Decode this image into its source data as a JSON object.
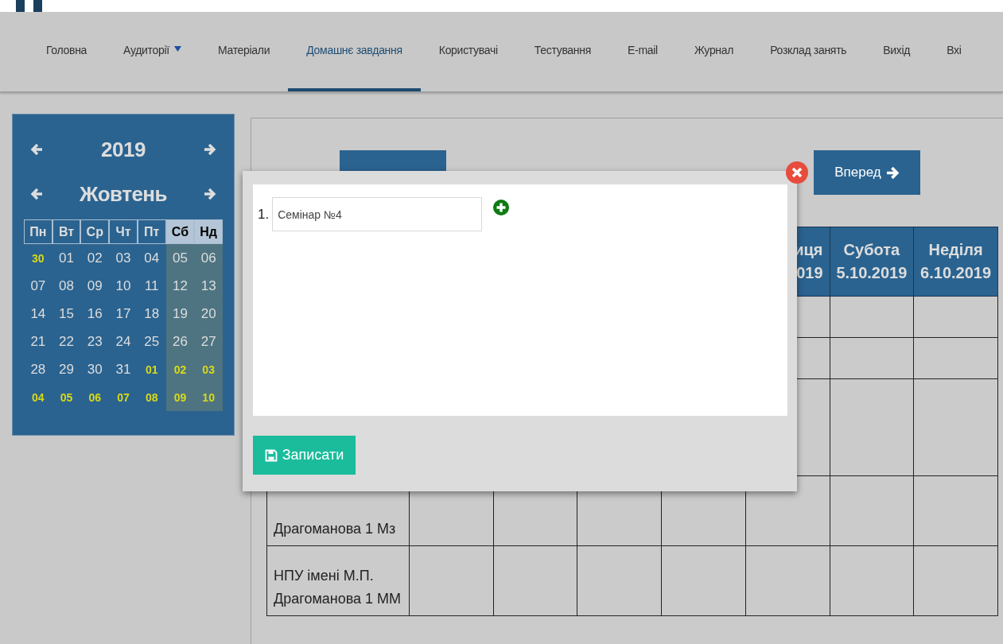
{
  "nav": {
    "items": [
      {
        "label": "Головна",
        "selected": false,
        "has_menu": false
      },
      {
        "label": "Аудиторії",
        "selected": false,
        "has_menu": true
      },
      {
        "label": "Матеріали",
        "selected": false,
        "has_menu": false
      },
      {
        "label": "Домашнє завдання",
        "selected": true,
        "has_menu": false
      },
      {
        "label": "Користувачі",
        "selected": false,
        "has_menu": false
      },
      {
        "label": "Тестування",
        "selected": false,
        "has_menu": false
      },
      {
        "label": "E-mail",
        "selected": false,
        "has_menu": false
      },
      {
        "label": "Журнал",
        "selected": false,
        "has_menu": false
      },
      {
        "label": "Розклад занять",
        "selected": false,
        "has_menu": false
      },
      {
        "label": "Вихід",
        "selected": false,
        "has_menu": false
      },
      {
        "label": "Вхі",
        "selected": false,
        "has_menu": false
      }
    ]
  },
  "calendar": {
    "year": "2019",
    "month": "Жовтень",
    "weekdays": [
      {
        "label": "Пн",
        "weekend": false
      },
      {
        "label": "Вт",
        "weekend": false
      },
      {
        "label": "Ср",
        "weekend": false
      },
      {
        "label": "Чт",
        "weekend": false
      },
      {
        "label": "Пт",
        "weekend": false
      },
      {
        "label": "Сб",
        "weekend": true
      },
      {
        "label": "Нд",
        "weekend": true
      }
    ],
    "weeks": [
      [
        {
          "day": "30",
          "other_month": true
        },
        {
          "day": "01",
          "other_month": false
        },
        {
          "day": "02",
          "other_month": false
        },
        {
          "day": "03",
          "other_month": false
        },
        {
          "day": "04",
          "other_month": false
        },
        {
          "day": "05",
          "other_month": false
        },
        {
          "day": "06",
          "other_month": false
        }
      ],
      [
        {
          "day": "07",
          "other_month": false
        },
        {
          "day": "08",
          "other_month": false
        },
        {
          "day": "09",
          "other_month": false
        },
        {
          "day": "10",
          "other_month": false
        },
        {
          "day": "11",
          "other_month": false
        },
        {
          "day": "12",
          "other_month": false
        },
        {
          "day": "13",
          "other_month": false
        }
      ],
      [
        {
          "day": "14",
          "other_month": false
        },
        {
          "day": "15",
          "other_month": false
        },
        {
          "day": "16",
          "other_month": false
        },
        {
          "day": "17",
          "other_month": false
        },
        {
          "day": "18",
          "other_month": false
        },
        {
          "day": "19",
          "other_month": false
        },
        {
          "day": "20",
          "other_month": false
        }
      ],
      [
        {
          "day": "21",
          "other_month": false
        },
        {
          "day": "22",
          "other_month": false
        },
        {
          "day": "23",
          "other_month": false
        },
        {
          "day": "24",
          "other_month": false
        },
        {
          "day": "25",
          "other_month": false
        },
        {
          "day": "26",
          "other_month": false
        },
        {
          "day": "27",
          "other_month": false
        }
      ],
      [
        {
          "day": "28",
          "other_month": false
        },
        {
          "day": "29",
          "other_month": false
        },
        {
          "day": "30",
          "other_month": false
        },
        {
          "day": "31",
          "other_month": false
        },
        {
          "day": "01",
          "other_month": true
        },
        {
          "day": "02",
          "other_month": true
        },
        {
          "day": "03",
          "other_month": true
        }
      ],
      [
        {
          "day": "04",
          "other_month": true
        },
        {
          "day": "05",
          "other_month": true
        },
        {
          "day": "06",
          "other_month": true
        },
        {
          "day": "07",
          "other_month": true
        },
        {
          "day": "08",
          "other_month": true
        },
        {
          "day": "09",
          "other_month": true
        },
        {
          "day": "10",
          "other_month": true
        }
      ]
    ]
  },
  "week": {
    "forward_button": "Вперед",
    "table": {
      "columns": [
        {
          "lines": [
            "иця",
            "019"
          ]
        },
        {
          "lines": [
            "Субота",
            "5.10.2019"
          ]
        },
        {
          "lines": [
            "Неділя",
            "6.10.2019"
          ]
        }
      ],
      "rows": [
        {
          "label": "Драгоманова 1 Мз"
        },
        {
          "label": "НПУ імені М.П. Драгоманова 1 ММ"
        }
      ]
    }
  },
  "dialog": {
    "items": [
      {
        "number": "1.",
        "value": "Семінар №4"
      }
    ],
    "save_button": "Записати"
  }
}
